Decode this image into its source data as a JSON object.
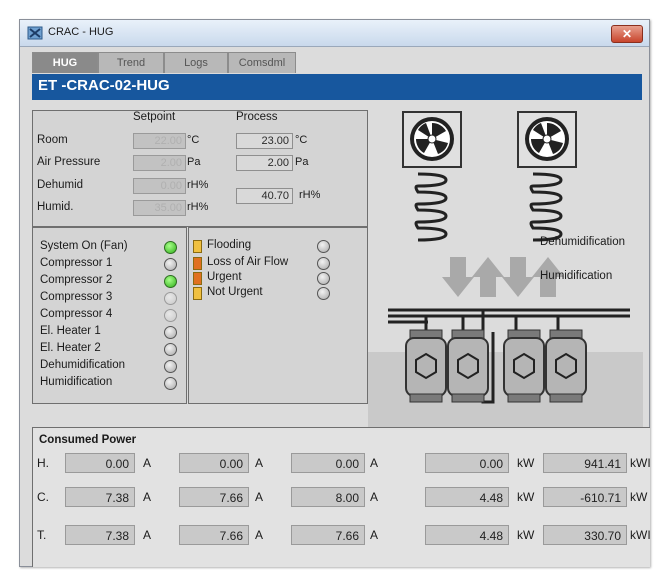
{
  "window": {
    "title": "CRAC - HUG",
    "close_glyph": "✕"
  },
  "tabs": [
    {
      "label": "HUG",
      "active": true
    },
    {
      "label": "Trend",
      "active": false
    },
    {
      "label": "Logs",
      "active": false
    },
    {
      "label": "Comsdml",
      "active": false
    }
  ],
  "header": {
    "title": "ET -CRAC-02-HUG"
  },
  "params": {
    "setpoint_header": "Setpoint",
    "process_header": "Process",
    "rows": [
      {
        "label": "Room",
        "setpoint": "22.00",
        "sp_unit": "°C",
        "process": "23.00",
        "pv_unit": "°C"
      },
      {
        "label": "Air Pressure",
        "setpoint": "2.00",
        "sp_unit": "Pa",
        "process": "2.00",
        "pv_unit": "Pa"
      },
      {
        "label": "Dehumid",
        "setpoint": "0.00",
        "sp_unit": "rH%"
      },
      {
        "label": "Humid.",
        "setpoint": "35.00",
        "sp_unit": "rH%"
      }
    ],
    "humidity_process": "40.70",
    "humidity_unit": "rH%"
  },
  "status": {
    "items": [
      {
        "label": "System On (Fan)",
        "state": "green"
      },
      {
        "label": "Compressor 1",
        "state": "off"
      },
      {
        "label": "Compressor 2",
        "state": "green"
      },
      {
        "label": "Compressor 3",
        "state": "dim"
      },
      {
        "label": "Compressor 4",
        "state": "dim"
      },
      {
        "label": "El. Heater 1",
        "state": "off"
      },
      {
        "label": "El. Heater 2",
        "state": "off"
      },
      {
        "label": "Dehumidification",
        "state": "off"
      },
      {
        "label": "Humidification",
        "state": "off"
      }
    ]
  },
  "alarms": {
    "items": [
      {
        "label": "Flooding",
        "color": "#f0c040"
      },
      {
        "label": "Loss of Air Flow",
        "color": "#e07020"
      },
      {
        "label": "Urgent",
        "color": "#e07020"
      },
      {
        "label": "Not Urgent",
        "color": "#f0c040"
      }
    ]
  },
  "diagram": {
    "dehumidification_label": "Dehumidification",
    "humidification_label": "Humidification"
  },
  "power": {
    "title": "Consumed Power",
    "rows": [
      {
        "label": "H.",
        "a1": "0.00",
        "a2": "0.00",
        "a3": "0.00",
        "kw": "0.00",
        "kwh": "941.41"
      },
      {
        "label": "C.",
        "a1": "7.38",
        "a2": "7.66",
        "a3": "8.00",
        "kw": "4.48",
        "kwh": "-610.71"
      },
      {
        "label": "T.",
        "a1": "7.38",
        "a2": "7.66",
        "a3": "7.66",
        "kw": "4.48",
        "kwh": "330.70"
      }
    ],
    "units": {
      "amp": "A",
      "kw": "kW",
      "kwh_1": "kWI",
      "kwh_2": "kW",
      "kwh_3": "kWI"
    }
  }
}
